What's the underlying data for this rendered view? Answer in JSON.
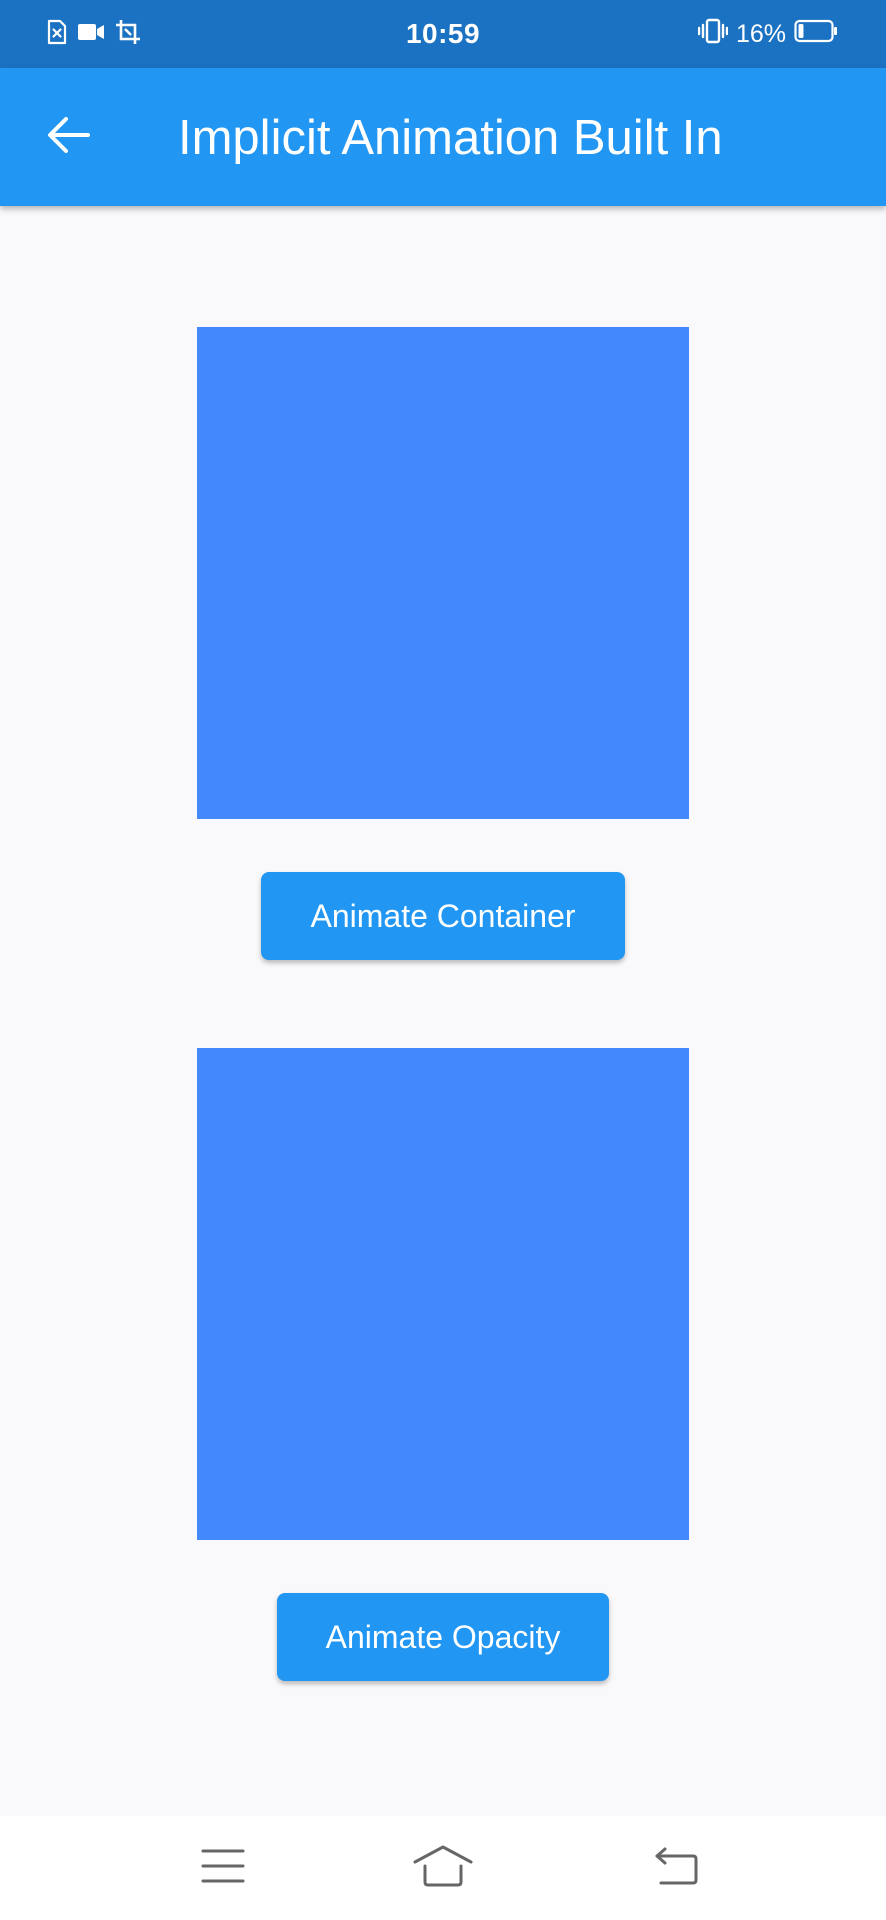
{
  "status_bar": {
    "time": "10:59",
    "battery_percent": "16%",
    "battery_level": 0.16,
    "left_icons": [
      "sim-error-icon",
      "video-camera-icon",
      "screenshot-crop-icon"
    ],
    "right_icons": [
      "vibrate-icon",
      "battery-icon"
    ],
    "background_color": "#1b72c2"
  },
  "app_bar": {
    "title": "Implicit Animation Built In",
    "back_icon": "arrow-back-icon",
    "background_color": "#2196f3"
  },
  "main": {
    "background_color": "#f9f8fb",
    "box_color": "#4388fd",
    "animate_container_label": "Animate Container",
    "animate_opacity_label": "Animate Opacity",
    "button_color": "#2196f3"
  },
  "nav_bar": {
    "icons": [
      "menu-icon",
      "home-icon",
      "back-icon"
    ]
  }
}
